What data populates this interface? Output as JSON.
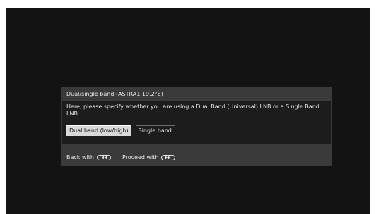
{
  "dialog": {
    "title": "Dual/single band (ASTRA1 19,2°E)",
    "message": "Here, please specify whether you are using a Dual Band (Universal) LNB or a Single Band LNB.",
    "options": [
      {
        "label": "Dual band (low/high)",
        "selected": true
      },
      {
        "label": "Single band",
        "selected": false
      }
    ],
    "footer": {
      "back_label": "Back with",
      "back_icon": "rewind-button-icon",
      "proceed_label": "Proceed with",
      "proceed_icon": "forward-button-icon"
    }
  },
  "colors": {
    "screen_background": "#131313",
    "dialog_background": "#3a3a3a",
    "dialog_body_background": "#1c1c1c",
    "selected_option_background": "#d9d9d9",
    "text": "#e8e8e8"
  }
}
